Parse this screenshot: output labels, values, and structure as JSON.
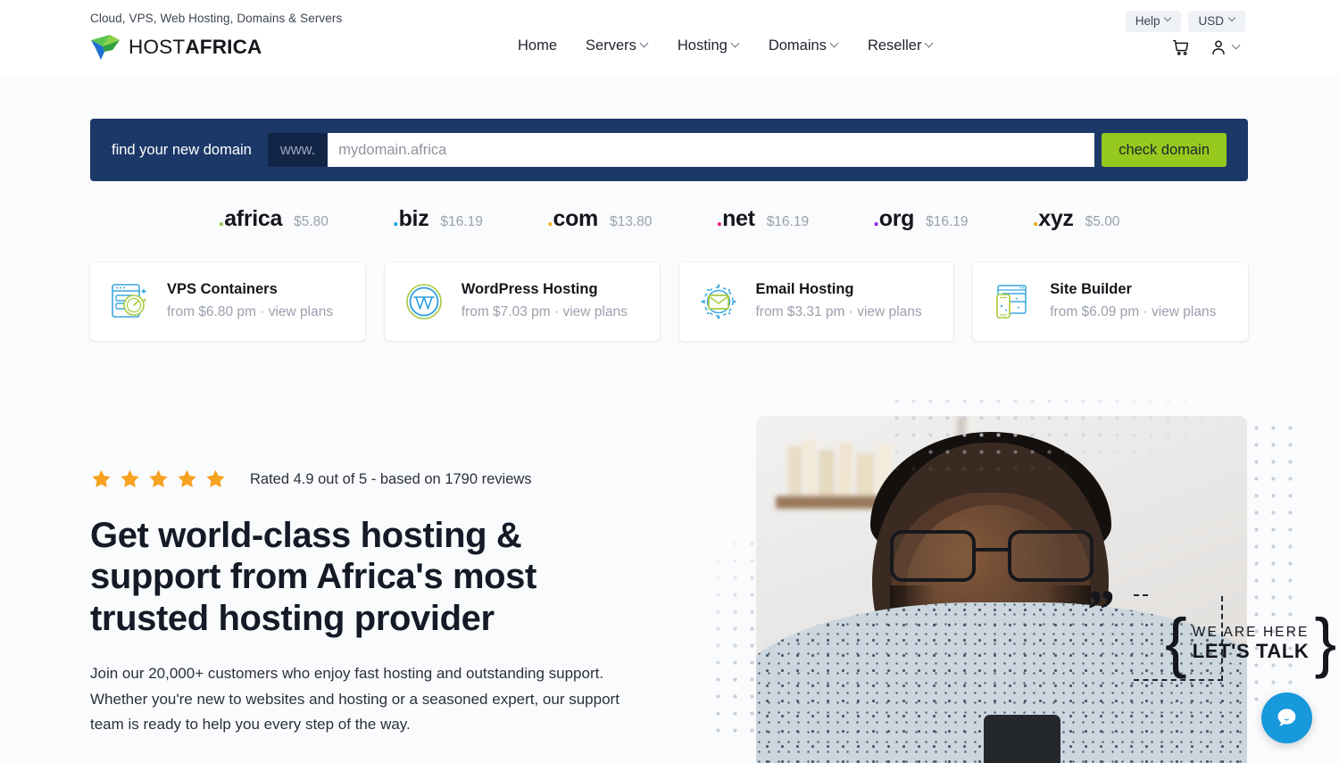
{
  "header": {
    "tagline": "Cloud, VPS, Web Hosting, Domains & Servers",
    "logo": {
      "part1": "HOST",
      "part2": "AFRICA",
      "icon": "hostafrica-logo-icon"
    },
    "nav": [
      {
        "label": "Home",
        "has_caret": false
      },
      {
        "label": "Servers",
        "has_caret": true
      },
      {
        "label": "Hosting",
        "has_caret": true
      },
      {
        "label": "Domains",
        "has_caret": true
      },
      {
        "label": "Reseller",
        "has_caret": true
      }
    ],
    "pills": [
      {
        "label": "Help",
        "name": "help-menu"
      },
      {
        "label": "USD",
        "name": "currency-menu"
      }
    ],
    "icons": [
      {
        "name": "cart-icon"
      },
      {
        "name": "user-account-icon"
      }
    ]
  },
  "domain_search": {
    "label": "find your new domain",
    "prefix": "www.",
    "input_value": "",
    "placeholder": "mydomain.africa",
    "button": "check domain",
    "bar_color": "#1c3868",
    "button_color": "#96c91e"
  },
  "tlds": [
    {
      "dot": ".",
      "name": "africa",
      "price": "$5.80",
      "dot_color": "#8cc63e"
    },
    {
      "dot": ".",
      "name": "biz",
      "price": "$16.19",
      "dot_color": "#1fa2e8"
    },
    {
      "dot": ".",
      "name": "com",
      "price": "$13.80",
      "dot_color": "#f5b417"
    },
    {
      "dot": ".",
      "name": "net",
      "price": "$16.19",
      "dot_color": "#e8197f"
    },
    {
      "dot": ".",
      "name": "org",
      "price": "$16.19",
      "dot_color": "#8a1fe8"
    },
    {
      "dot": ".",
      "name": "xyz",
      "price": "$5.00",
      "dot_color": "#f5a217"
    }
  ],
  "cards": [
    {
      "title": "VPS Containers",
      "sub": "from $6.80 pm · view plans",
      "icon": "vps-containers-icon"
    },
    {
      "title": "WordPress Hosting",
      "sub": "from $7.03 pm · view plans",
      "icon": "wordpress-icon"
    },
    {
      "title": "Email Hosting",
      "sub": "from $3.31 pm · view plans",
      "icon": "email-hosting-icon"
    },
    {
      "title": "Site Builder",
      "sub": "from $6.09 pm · view plans",
      "icon": "site-builder-icon"
    }
  ],
  "hero": {
    "stars": 5,
    "star_color": "#f7a221",
    "rating_text": "Rated 4.9 out of 5 - based on 1790 reviews",
    "title": "Get world-class hosting & support from Africa's most trusted hosting provider",
    "subtitle": "Join our 20,000+ customers who enjoy fast hosting and outstanding support. Whether you're new to websites and hosting or a seasoned expert, our support team is ready to help you every step of the way.",
    "badge": {
      "quote": "”",
      "top": "WE ARE HERE",
      "bottom": "LET'S TALK"
    },
    "image_alt": "smiling-man-with-glasses-using-phone"
  },
  "chat": {
    "icon": "chat-bubble-icon",
    "color": "#1799db"
  }
}
